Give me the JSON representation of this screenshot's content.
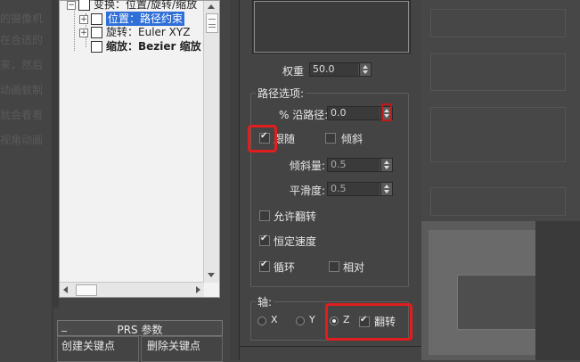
{
  "background_text": [
    "的摄像机",
    "在合适的",
    "来，然后",
    "动画就制",
    "就会看看",
    "视角动画"
  ],
  "tree": {
    "items": [
      {
        "label": "变换：位置/旋转/缩放",
        "selected": false
      },
      {
        "label": "位置：路径约束",
        "selected": true
      },
      {
        "label": "旋转：Euler XYZ",
        "selected": false
      },
      {
        "label": "缩放：Bezier 缩放",
        "selected": false
      }
    ]
  },
  "prs": {
    "title": "PRS 参数",
    "create_key": "创建关键点",
    "delete_key": "删除关键点"
  },
  "weight": {
    "label": "权重",
    "value": "50.0"
  },
  "path_options": {
    "title": "路径选项:",
    "percent_along": {
      "label": "% 沿路径:",
      "value": "0.0"
    },
    "follow": {
      "label": "跟随",
      "checked": true
    },
    "bank": {
      "label": "倾斜",
      "checked": false
    },
    "bank_amount": {
      "label": "倾斜量:",
      "value": "0.5"
    },
    "smoothness": {
      "label": "平滑度:",
      "value": "0.5"
    },
    "allow_upside_down": {
      "label": "允许翻转",
      "checked": false
    },
    "constant_velocity": {
      "label": "恒定速度",
      "checked": true
    },
    "loop": {
      "label": "循环",
      "checked": true
    },
    "relative": {
      "label": "相对",
      "checked": false
    }
  },
  "axis": {
    "title": "轴:",
    "x": {
      "label": "X",
      "selected": false
    },
    "y": {
      "label": "Y",
      "selected": false
    },
    "z": {
      "label": "Z",
      "selected": true
    },
    "flip": {
      "label": "翻转",
      "checked": true
    }
  },
  "colors": {
    "highlight": "#e11d1d",
    "selection": "#2f6fd8"
  }
}
